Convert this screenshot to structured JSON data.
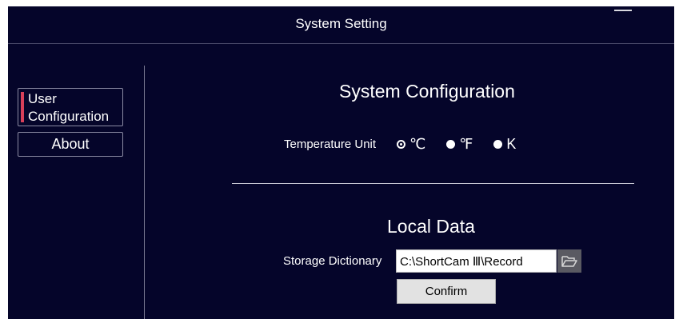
{
  "window": {
    "title": "System Setting"
  },
  "sidebar": {
    "items": [
      {
        "label_line1": "User",
        "label_line2": "Configuration",
        "active": true
      },
      {
        "label": "About"
      }
    ]
  },
  "system_config": {
    "title": "System Configuration",
    "temperature_label": "Temperature Unit",
    "options": [
      "℃",
      "℉",
      "K"
    ],
    "selected": "℃"
  },
  "local_data": {
    "title": "Local Data",
    "storage_label": "Storage Dictionary",
    "path_value": "C:\\ShortCam Ⅲ\\Record",
    "confirm_label": "Confirm"
  },
  "colors": {
    "background": "#05052a",
    "accent": "#d8405a"
  },
  "icons": {
    "folder": "folder-open-icon"
  }
}
